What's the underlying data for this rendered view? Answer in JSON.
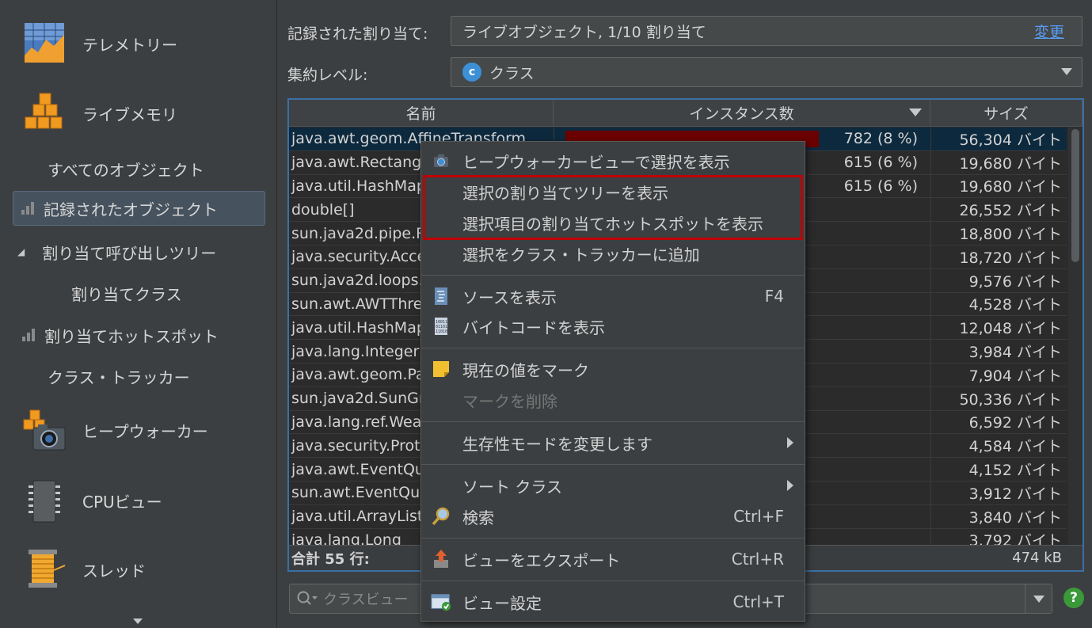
{
  "sidebar": {
    "telemetry": "テレメトリー",
    "live_memory": "ライブメモリ",
    "all_objects": "すべてのオブジェクト",
    "recorded_objects": "記録されたオブジェクト",
    "allocation_call_tree": "割り当て呼び出しツリー",
    "allocated_classes": "割り当てクラス",
    "allocation_hotspots": "割り当てホットスポット",
    "class_tracker": "クラス・トラッカー",
    "heap_walker": "ヒープウォーカー",
    "cpu_views": "CPUビュー",
    "threads": "スレッド"
  },
  "header": {
    "recorded_label": "記録された割り当て:",
    "recorded_value": "ライブオブジェクト, 1/10 割り当て",
    "change_link": "変更",
    "aggregation_label": "集約レベル:",
    "aggregation_value": "クラス"
  },
  "table": {
    "columns": [
      "名前",
      "インスタンス数",
      "サイズ"
    ],
    "rows": [
      {
        "name": "java.awt.geom.AffineTransform",
        "instances": "782 (8 %)",
        "size": "56,304 バイト",
        "fraction": 0.08
      },
      {
        "name": "java.awt.Rectangle",
        "instances": "615 (6 %)",
        "size": "19,680 バイト",
        "fraction": 0.06
      },
      {
        "name": "java.util.HashMap$Node",
        "instances": "615 (6 %)",
        "size": "19,680 バイト",
        "fraction": 0.06
      },
      {
        "name": "double[]",
        "instances": "",
        "size": "26,552 バイト",
        "fraction": 0.05
      },
      {
        "name": "sun.java2d.pipe.Region",
        "instances": "",
        "size": "18,800 バイト",
        "fraction": 0.04
      },
      {
        "name": "java.security.AccessControlContext",
        "instances": "",
        "size": "18,720 バイト",
        "fraction": 0.04
      },
      {
        "name": "sun.java2d.loops.FontInfo",
        "instances": "",
        "size": "9,576 バイト",
        "fraction": 0.03
      },
      {
        "name": "sun.awt.AWTThreading",
        "instances": "",
        "size": "4,528 バイト",
        "fraction": 0.03
      },
      {
        "name": "java.util.HashMap",
        "instances": "",
        "size": "12,048 バイト",
        "fraction": 0.03
      },
      {
        "name": "java.lang.Integer",
        "instances": "",
        "size": "3,984 バイト",
        "fraction": 0.02
      },
      {
        "name": "java.awt.geom.Path2D",
        "instances": "",
        "size": "7,904 バイト",
        "fraction": 0.02
      },
      {
        "name": "sun.java2d.SunGraphics2D",
        "instances": "",
        "size": "50,336 バイト",
        "fraction": 0.02
      },
      {
        "name": "java.lang.ref.WeakReference",
        "instances": "",
        "size": "6,592 バイト",
        "fraction": 0.02
      },
      {
        "name": "java.security.ProtectionDomain",
        "instances": "",
        "size": "4,584 バイト",
        "fraction": 0.02
      },
      {
        "name": "java.awt.EventQueue",
        "instances": "",
        "size": "4,152 バイト",
        "fraction": 0.02
      },
      {
        "name": "sun.awt.EventQueueItem",
        "instances": "",
        "size": "3,912 バイト",
        "fraction": 0.02
      },
      {
        "name": "java.util.ArrayList",
        "instances": "",
        "size": "3,840 バイト",
        "fraction": 0.02
      },
      {
        "name": "java.lang.Long",
        "instances": "",
        "size": "3,792 バイト",
        "fraction": 0.02
      }
    ],
    "footer_total": "合計 55 行:",
    "footer_size": "474 kB"
  },
  "search": {
    "placeholder": "クラスビュー"
  },
  "menu": {
    "show_in_heapwalker": "ヒープウォーカービューで選択を表示",
    "show_alloc_tree": "選択の割り当てツリーを表示",
    "show_alloc_hotspots": "選択項目の割り当てホットスポットを表示",
    "add_to_class_tracker": "選択をクラス・トラッカーに追加",
    "show_source": "ソースを表示",
    "show_source_sc": "F4",
    "show_bytecode": "バイトコードを表示",
    "mark_current": "現在の値をマーク",
    "remove_mark": "マークを削除",
    "change_liveness": "生存性モードを変更します",
    "sort_classes": "ソート クラス",
    "find": "検索",
    "find_sc": "Ctrl+F",
    "export_view": "ビューをエクスポート",
    "export_sc": "Ctrl+R",
    "view_settings": "ビュー設定",
    "view_settings_sc": "Ctrl+T"
  },
  "colors": {
    "selection": "#0d293e",
    "bar": "#6b0000",
    "highlight_box": "#c00000",
    "accent": "#3a6fa6"
  }
}
